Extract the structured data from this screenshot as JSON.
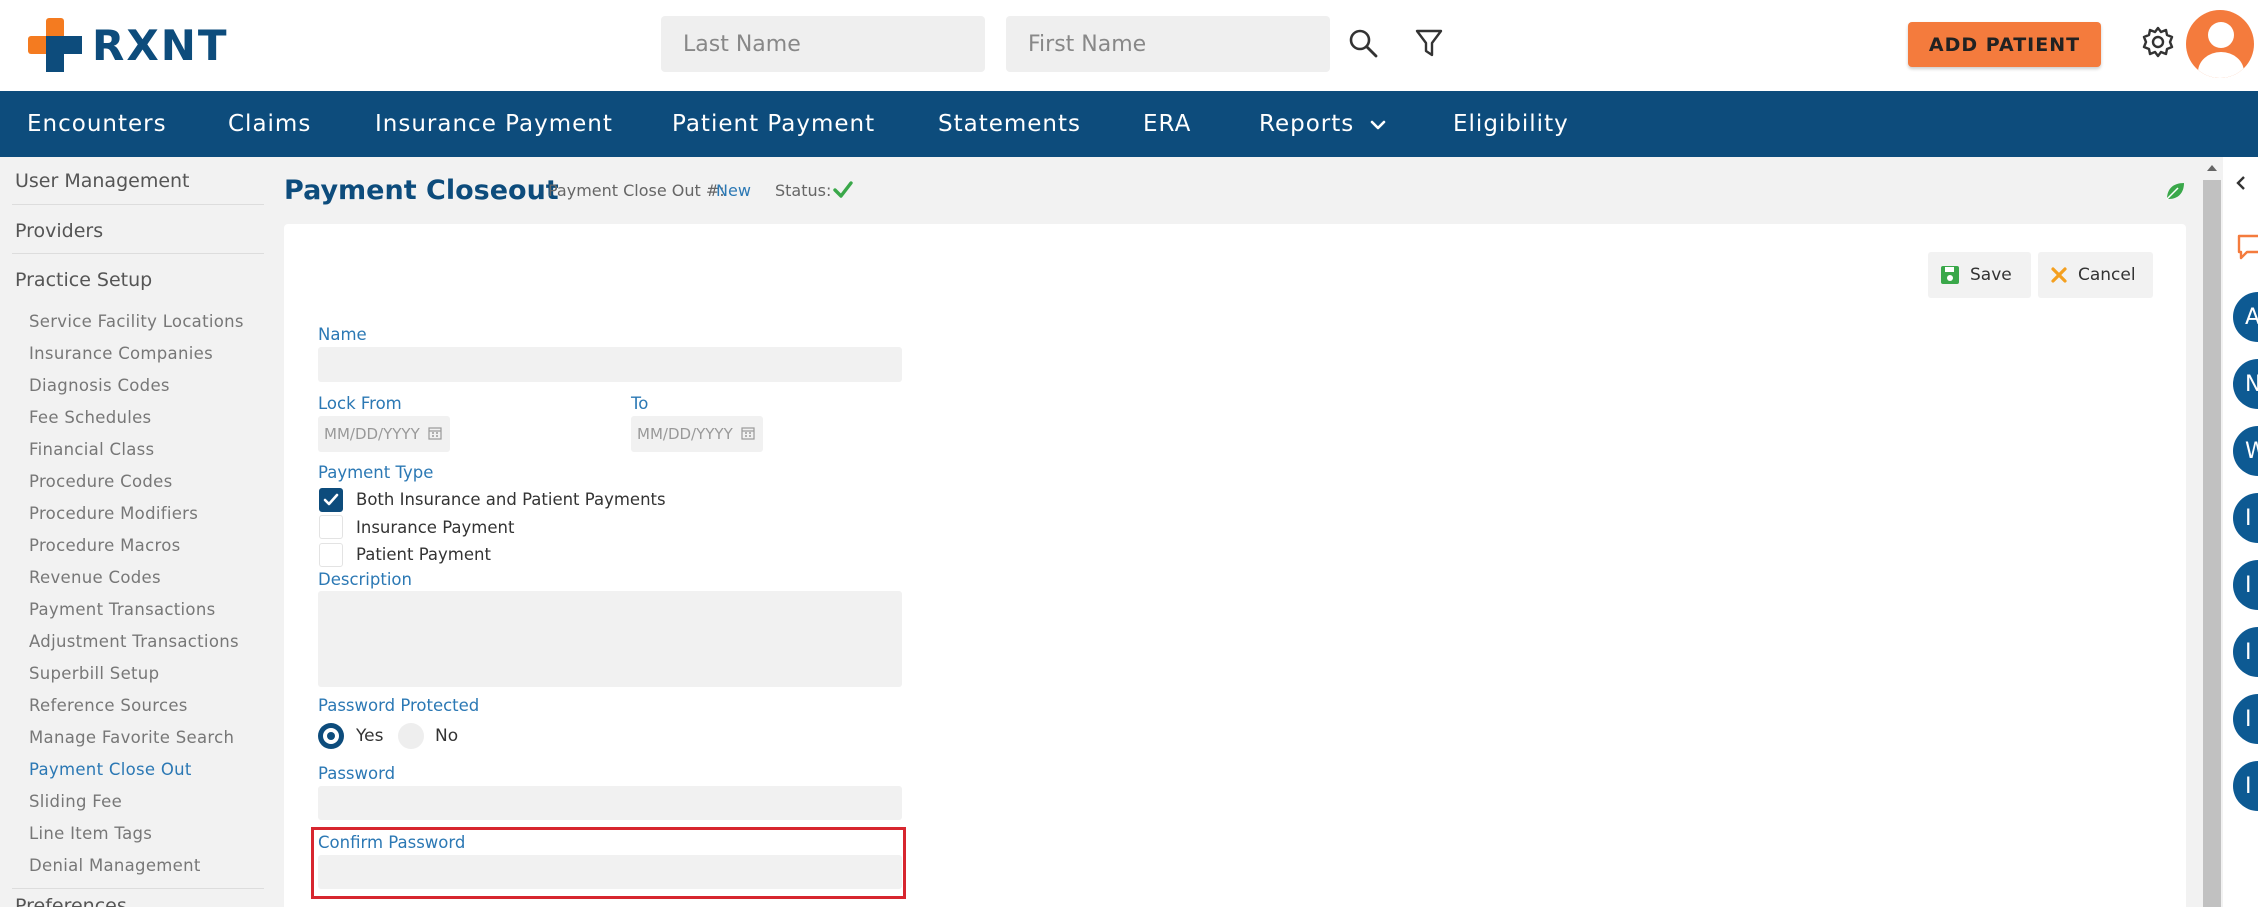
{
  "header": {
    "logo_text": "RXNT",
    "last_name_placeholder": "Last Name",
    "first_name_placeholder": "First Name",
    "add_patient_label": "ADD PATIENT"
  },
  "nav": {
    "items": [
      "Encounters",
      "Claims",
      "Insurance Payment",
      "Patient Payment",
      "Statements",
      "ERA",
      "Reports",
      "Eligibility"
    ]
  },
  "sidebar": {
    "top_items": [
      "User Management",
      "Providers",
      "Practice Setup"
    ],
    "sub_items": [
      "Service Facility Locations",
      "Insurance Companies",
      "Diagnosis Codes",
      "Fee Schedules",
      "Financial Class",
      "Procedure Codes",
      "Procedure Modifiers",
      "Procedure Macros",
      "Revenue Codes",
      "Payment Transactions",
      "Adjustment Transactions",
      "Superbill Setup",
      "Reference Sources",
      "Manage Favorite Search",
      "Payment Close Out",
      "Sliding Fee",
      "Line Item Tags",
      "Denial Management"
    ],
    "active_item": "Payment Close Out",
    "bottom_item": "Preferences"
  },
  "page": {
    "title": "Payment Closeout",
    "closeout_label": "Payment Close Out #:",
    "closeout_value": "New",
    "status_label": "Status:"
  },
  "actions": {
    "save_label": "Save",
    "cancel_label": "Cancel"
  },
  "form": {
    "name_label": "Name",
    "name_value": "",
    "lock_from_label": "Lock From",
    "lock_from_placeholder": "MM/DD/YYYY",
    "to_label": "To",
    "to_placeholder": "MM/DD/YYYY",
    "payment_type_label": "Payment Type",
    "payment_types": [
      {
        "label": "Both Insurance and Patient Payments",
        "checked": true
      },
      {
        "label": "Insurance Payment",
        "checked": false
      },
      {
        "label": "Patient Payment",
        "checked": false
      }
    ],
    "description_label": "Description",
    "password_protected_label": "Password Protected",
    "yes_label": "Yes",
    "no_label": "No",
    "password_protected_value": "Yes",
    "password_label": "Password",
    "confirm_password_label": "Confirm Password"
  },
  "right_rail": {
    "letters": [
      "A",
      "N",
      "W",
      "I",
      "I",
      "I",
      "I",
      "I"
    ]
  },
  "colors": {
    "brand_navy": "#0d4c7c",
    "brand_orange": "#f47b3d",
    "link_blue": "#2b78b4",
    "success_green": "#3aa84a",
    "highlight_red": "#d7262f"
  }
}
